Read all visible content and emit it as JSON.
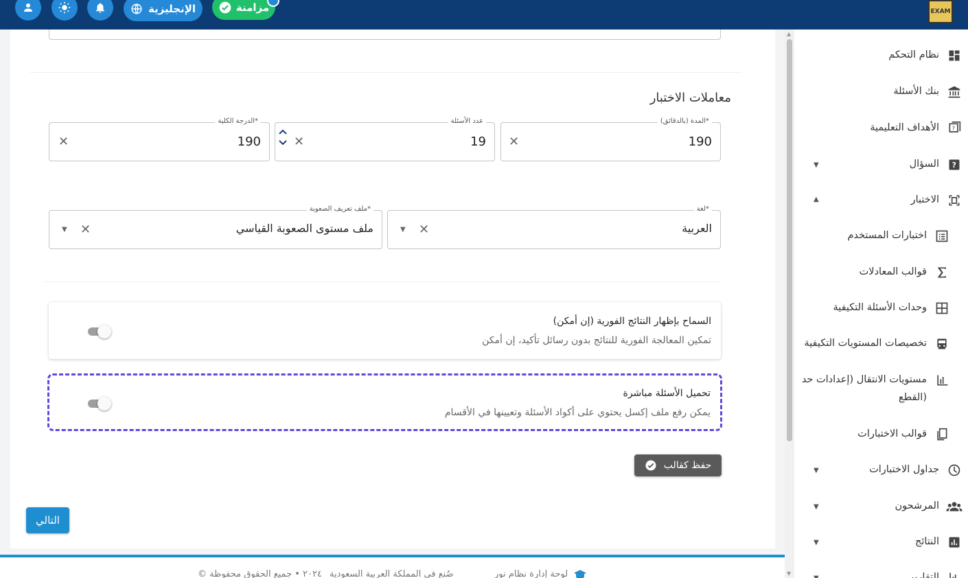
{
  "topbar": {
    "language_label": "الإنجليزية",
    "sync_label": "مزامنة",
    "logo_text": "EXAM"
  },
  "section": {
    "title": "معاملات الاختبار"
  },
  "fields": {
    "total_degree": {
      "label": "الدرجة الكلية*",
      "value": "190"
    },
    "questions_count": {
      "label": "عدد الأسئلة",
      "value": "19"
    },
    "duration": {
      "label": "المدة (بالدقائق)*",
      "value": "190"
    },
    "difficulty_profile": {
      "label": "ملف تعريف الصعوبة*",
      "value": "ملف مستوى الصعوبة القياسي"
    },
    "language": {
      "label": "لغة*",
      "value": "العربية"
    }
  },
  "toggles": {
    "instant_results": {
      "title": "السماح بإظهار النتائج الفورية (إن أمكن)",
      "description": "تمكين المعالجة الفورية للنتائج بدون رسائل تأكيد، إن أمكن",
      "on": false
    },
    "direct_upload": {
      "title": "تحميل الأسئلة مباشرة",
      "description": "يمكن رفع ملف إكسل يحتوي على أكواد الأسئلة وتعيينها في الأقسام",
      "on": false
    }
  },
  "buttons": {
    "save_template": "حفظ كقالب",
    "next": "التالي"
  },
  "footer": {
    "brand": "لوحة إدارة نظام نور",
    "made_in": "صُنع في المملكة العربية السعودية",
    "rights": "© ٢٠٢٤ • جميع الحقوق محفوظة"
  },
  "sidebar": {
    "items": [
      {
        "label": "نظام التحكم",
        "icon": "dashboard-icon",
        "has_chevron": false
      },
      {
        "label": "بنك الأسئلة",
        "icon": "bank-icon",
        "has_chevron": false
      },
      {
        "label": "الأهداف التعليمية",
        "icon": "objectives-icon",
        "has_chevron": false
      },
      {
        "label": "السؤال",
        "icon": "question-icon",
        "has_chevron": true,
        "expanded": false
      },
      {
        "label": "الاختبار",
        "icon": "exam-icon",
        "has_chevron": true,
        "expanded": true
      },
      {
        "label": "اختبارات المستخدم",
        "icon": "list-icon",
        "sub": true
      },
      {
        "label": "قوالب المعادلات",
        "icon": "sigma-icon",
        "sub": true
      },
      {
        "label": "وحدات الأسئلة التكيفية",
        "icon": "grid-icon",
        "sub": true
      },
      {
        "label": "تخصيصات المستويات التكيفية",
        "icon": "train-icon",
        "sub": true
      },
      {
        "label": "مستويات الانتقال (إعدادات حد",
        "label2": "القطع)",
        "icon": "bar-chart-icon",
        "sub": true
      },
      {
        "label": "قوالب الاختبارات",
        "icon": "template-icon",
        "sub": true
      },
      {
        "label": "جداول الاختبارات",
        "icon": "clock-icon",
        "has_chevron": true,
        "expanded": false
      },
      {
        "label": "المرشحون",
        "icon": "people-icon",
        "has_chevron": true,
        "expanded": false
      },
      {
        "label": "النتائج",
        "icon": "results-icon",
        "has_chevron": true,
        "expanded": false
      },
      {
        "label": "التقارير",
        "icon": "report-icon",
        "has_chevron": true,
        "expanded": false
      }
    ]
  }
}
